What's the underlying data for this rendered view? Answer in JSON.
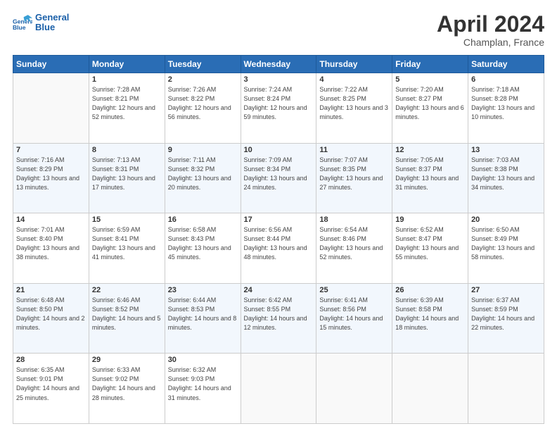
{
  "header": {
    "logo_line1": "General",
    "logo_line2": "Blue",
    "title": "April 2024",
    "location": "Champlan, France"
  },
  "days_of_week": [
    "Sunday",
    "Monday",
    "Tuesday",
    "Wednesday",
    "Thursday",
    "Friday",
    "Saturday"
  ],
  "weeks": [
    [
      {
        "day": "",
        "sunrise": "",
        "sunset": "",
        "daylight": ""
      },
      {
        "day": "1",
        "sunrise": "7:28 AM",
        "sunset": "8:21 PM",
        "daylight": "12 hours and 52 minutes."
      },
      {
        "day": "2",
        "sunrise": "7:26 AM",
        "sunset": "8:22 PM",
        "daylight": "12 hours and 56 minutes."
      },
      {
        "day": "3",
        "sunrise": "7:24 AM",
        "sunset": "8:24 PM",
        "daylight": "12 hours and 59 minutes."
      },
      {
        "day": "4",
        "sunrise": "7:22 AM",
        "sunset": "8:25 PM",
        "daylight": "13 hours and 3 minutes."
      },
      {
        "day": "5",
        "sunrise": "7:20 AM",
        "sunset": "8:27 PM",
        "daylight": "13 hours and 6 minutes."
      },
      {
        "day": "6",
        "sunrise": "7:18 AM",
        "sunset": "8:28 PM",
        "daylight": "13 hours and 10 minutes."
      }
    ],
    [
      {
        "day": "7",
        "sunrise": "7:16 AM",
        "sunset": "8:29 PM",
        "daylight": "13 hours and 13 minutes."
      },
      {
        "day": "8",
        "sunrise": "7:13 AM",
        "sunset": "8:31 PM",
        "daylight": "13 hours and 17 minutes."
      },
      {
        "day": "9",
        "sunrise": "7:11 AM",
        "sunset": "8:32 PM",
        "daylight": "13 hours and 20 minutes."
      },
      {
        "day": "10",
        "sunrise": "7:09 AM",
        "sunset": "8:34 PM",
        "daylight": "13 hours and 24 minutes."
      },
      {
        "day": "11",
        "sunrise": "7:07 AM",
        "sunset": "8:35 PM",
        "daylight": "13 hours and 27 minutes."
      },
      {
        "day": "12",
        "sunrise": "7:05 AM",
        "sunset": "8:37 PM",
        "daylight": "13 hours and 31 minutes."
      },
      {
        "day": "13",
        "sunrise": "7:03 AM",
        "sunset": "8:38 PM",
        "daylight": "13 hours and 34 minutes."
      }
    ],
    [
      {
        "day": "14",
        "sunrise": "7:01 AM",
        "sunset": "8:40 PM",
        "daylight": "13 hours and 38 minutes."
      },
      {
        "day": "15",
        "sunrise": "6:59 AM",
        "sunset": "8:41 PM",
        "daylight": "13 hours and 41 minutes."
      },
      {
        "day": "16",
        "sunrise": "6:58 AM",
        "sunset": "8:43 PM",
        "daylight": "13 hours and 45 minutes."
      },
      {
        "day": "17",
        "sunrise": "6:56 AM",
        "sunset": "8:44 PM",
        "daylight": "13 hours and 48 minutes."
      },
      {
        "day": "18",
        "sunrise": "6:54 AM",
        "sunset": "8:46 PM",
        "daylight": "13 hours and 52 minutes."
      },
      {
        "day": "19",
        "sunrise": "6:52 AM",
        "sunset": "8:47 PM",
        "daylight": "13 hours and 55 minutes."
      },
      {
        "day": "20",
        "sunrise": "6:50 AM",
        "sunset": "8:49 PM",
        "daylight": "13 hours and 58 minutes."
      }
    ],
    [
      {
        "day": "21",
        "sunrise": "6:48 AM",
        "sunset": "8:50 PM",
        "daylight": "14 hours and 2 minutes."
      },
      {
        "day": "22",
        "sunrise": "6:46 AM",
        "sunset": "8:52 PM",
        "daylight": "14 hours and 5 minutes."
      },
      {
        "day": "23",
        "sunrise": "6:44 AM",
        "sunset": "8:53 PM",
        "daylight": "14 hours and 8 minutes."
      },
      {
        "day": "24",
        "sunrise": "6:42 AM",
        "sunset": "8:55 PM",
        "daylight": "14 hours and 12 minutes."
      },
      {
        "day": "25",
        "sunrise": "6:41 AM",
        "sunset": "8:56 PM",
        "daylight": "14 hours and 15 minutes."
      },
      {
        "day": "26",
        "sunrise": "6:39 AM",
        "sunset": "8:58 PM",
        "daylight": "14 hours and 18 minutes."
      },
      {
        "day": "27",
        "sunrise": "6:37 AM",
        "sunset": "8:59 PM",
        "daylight": "14 hours and 22 minutes."
      }
    ],
    [
      {
        "day": "28",
        "sunrise": "6:35 AM",
        "sunset": "9:01 PM",
        "daylight": "14 hours and 25 minutes."
      },
      {
        "day": "29",
        "sunrise": "6:33 AM",
        "sunset": "9:02 PM",
        "daylight": "14 hours and 28 minutes."
      },
      {
        "day": "30",
        "sunrise": "6:32 AM",
        "sunset": "9:03 PM",
        "daylight": "14 hours and 31 minutes."
      },
      {
        "day": "",
        "sunrise": "",
        "sunset": "",
        "daylight": ""
      },
      {
        "day": "",
        "sunrise": "",
        "sunset": "",
        "daylight": ""
      },
      {
        "day": "",
        "sunrise": "",
        "sunset": "",
        "daylight": ""
      },
      {
        "day": "",
        "sunrise": "",
        "sunset": "",
        "daylight": ""
      }
    ]
  ]
}
